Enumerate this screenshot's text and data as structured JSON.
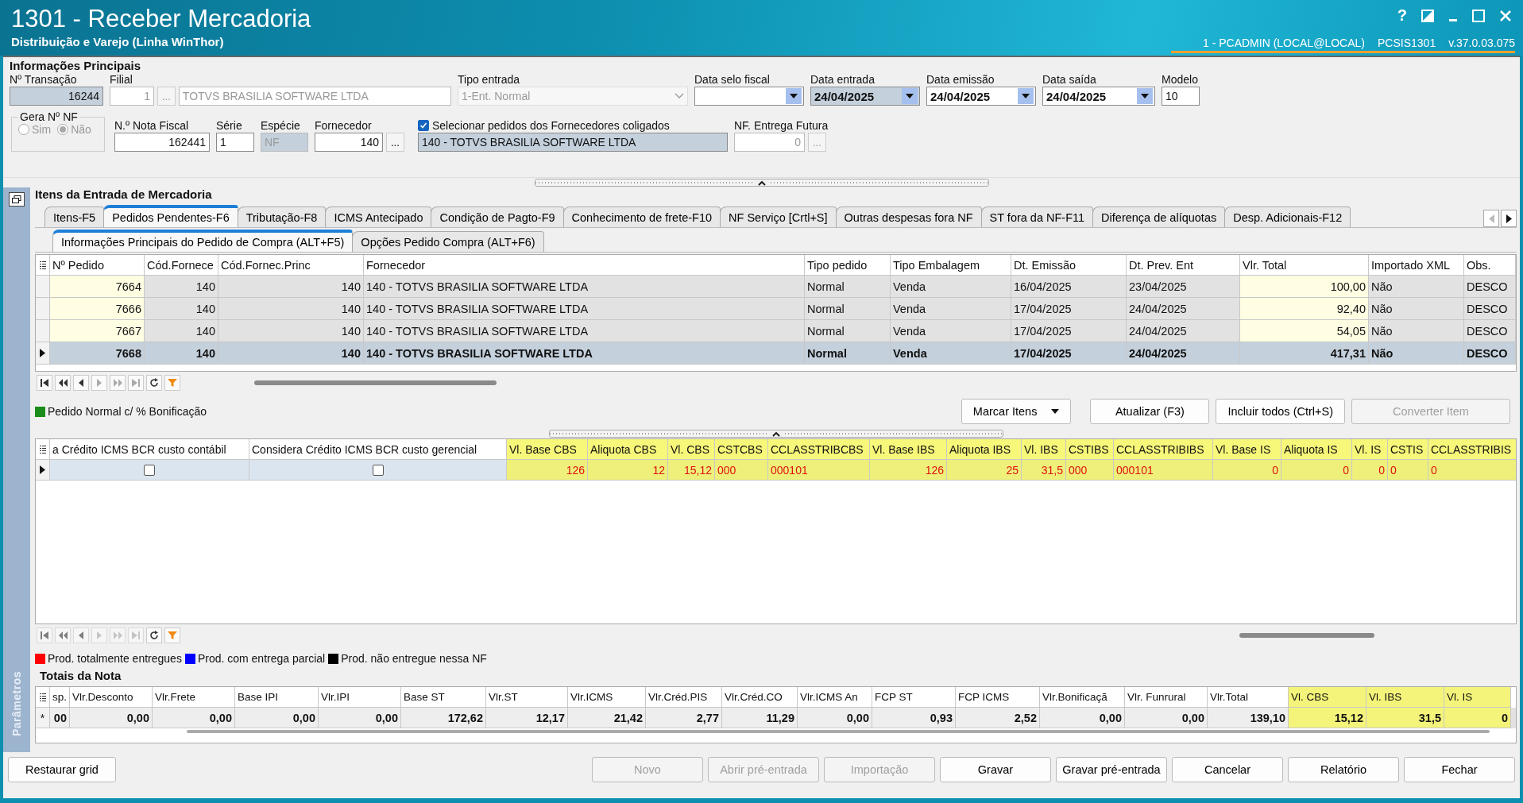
{
  "window": {
    "title": "1301 - Receber Mercadoria",
    "subtitle": "Distribuição e Varejo (Linha WinThor)",
    "help": "?",
    "user": "1 - PCADMIN (LOCAL@LOCAL)",
    "program": "PCSIS1301",
    "version": "v.37.0.03.075"
  },
  "main_info": {
    "heading": "Informações Principais",
    "row1": [
      {
        "kind": "text",
        "label": "Nº Transação",
        "value": "16244",
        "readonly": true,
        "disabled": false
      },
      {
        "kind": "lookup",
        "label": "Filial",
        "value": "1",
        "button": "...",
        "name": "TOTVS BRASILIA SOFTWARE LTDA",
        "readonly": false,
        "disabled": true
      },
      {
        "kind": "select",
        "label": "Tipo entrada",
        "value": "1-Ent. Normal",
        "readonly": false,
        "disabled": true
      },
      {
        "kind": "date",
        "label": "Data selo fiscal",
        "readonly": false,
        "disabled": false
      },
      {
        "kind": "date",
        "label": "Data entrada",
        "value": "24/04/2025",
        "readonly": true,
        "disabled": false
      },
      {
        "kind": "date",
        "label": "Data emissão",
        "value": "24/04/2025",
        "readonly": false,
        "disabled": false
      },
      {
        "kind": "date",
        "label": "Data saída",
        "value": "24/04/2025",
        "readonly": false,
        "disabled": false
      },
      {
        "kind": "text",
        "label": "Modelo",
        "value": "10",
        "readonly": false,
        "disabled": false
      }
    ],
    "gera_nf": {
      "label": "Gera Nº NF",
      "disabled": true,
      "options": [
        {
          "label": "Sim",
          "selected": false
        },
        {
          "label": "Não",
          "selected": true
        }
      ]
    },
    "row2": [
      {
        "kind": "text",
        "label": "N.º Nota Fiscal",
        "value": "162441",
        "readonly": false,
        "disabled": false
      },
      {
        "kind": "text",
        "label": "Série",
        "value": "1",
        "readonly": false,
        "disabled": false
      },
      {
        "kind": "text",
        "label": "Espécie",
        "value": "NF",
        "readonly": true,
        "disabled": true
      },
      {
        "kind": "lookup",
        "label": "Fornecedor",
        "value": "140",
        "button": "...",
        "readonly": false,
        "disabled": false
      },
      {
        "kind": "checkname",
        "label": "Selecionar pedidos dos Fornecedores coligados",
        "checked": true,
        "value": "140 - TOTVS BRASILIA SOFTWARE LTDA",
        "readonly": true
      },
      {
        "kind": "lookup",
        "label": "NF. Entrega Futura",
        "value": "0",
        "button": "...",
        "readonly": false,
        "disabled": true
      }
    ]
  },
  "items": {
    "heading": "Itens da Entrada de Mercadoria",
    "tabs": [
      {
        "label": "Itens-F5",
        "selected": false
      },
      {
        "label": "Pedidos Pendentes-F6",
        "selected": true
      },
      {
        "label": "Tributação-F8",
        "selected": false
      },
      {
        "label": "ICMS Antecipado",
        "selected": false
      },
      {
        "label": "Condição de Pagto-F9",
        "selected": false
      },
      {
        "label": "Conhecimento de frete-F10",
        "selected": false
      },
      {
        "label": "NF Serviço [Crtl+S]",
        "selected": false
      },
      {
        "label": "Outras despesas fora NF",
        "selected": false
      },
      {
        "label": "ST fora da NF-F11",
        "selected": false
      },
      {
        "label": "Diferença de alíquotas",
        "selected": false
      },
      {
        "label": "Desp. Adicionais-F12",
        "selected": false
      }
    ],
    "subtabs": [
      {
        "label": "Informações Principais do Pedido de Compra (ALT+F5)",
        "selected": true
      },
      {
        "label": "Opções Pedido Compra (ALT+F6)",
        "selected": false
      }
    ]
  },
  "orders": {
    "columns": [
      {
        "label": "Nº Pedido",
        "highlight": true
      },
      {
        "label": "Cód.Fornece",
        "highlight": false
      },
      {
        "label": "Cód.Fornec.Princ",
        "highlight": false
      },
      {
        "label": "Fornecedor",
        "highlight": false
      },
      {
        "label": "Tipo pedido",
        "highlight": false
      },
      {
        "label": "Tipo Embalagem",
        "highlight": false
      },
      {
        "label": "Dt. Emissão",
        "highlight": false
      },
      {
        "label": "Dt. Prev. Ent",
        "highlight": false
      },
      {
        "label": "Vlr. Total",
        "highlight": true
      },
      {
        "label": "Importado XML",
        "highlight": false
      },
      {
        "label": "Obs.",
        "highlight": false
      }
    ],
    "rows": [
      {
        "selected": false,
        "cells": [
          "7664",
          "140",
          "140",
          "140 - TOTVS BRASILIA SOFTWARE LTDA",
          "Normal",
          "Venda",
          "16/04/2025",
          "23/04/2025",
          "100,00",
          "Não",
          "DESCO"
        ]
      },
      {
        "selected": false,
        "cells": [
          "7666",
          "140",
          "140",
          "140 - TOTVS BRASILIA SOFTWARE LTDA",
          "Normal",
          "Venda",
          "17/04/2025",
          "24/04/2025",
          "92,40",
          "Não",
          "DESCO"
        ]
      },
      {
        "selected": false,
        "cells": [
          "7667",
          "140",
          "140",
          "140 - TOTVS BRASILIA SOFTWARE LTDA",
          "Normal",
          "Venda",
          "17/04/2025",
          "24/04/2025",
          "54,05",
          "Não",
          "DESCO"
        ]
      },
      {
        "selected": true,
        "cells": [
          "7668",
          "140",
          "140",
          "140 - TOTVS BRASILIA SOFTWARE LTDA",
          "Normal",
          "Venda",
          "17/04/2025",
          "24/04/2025",
          "417,31",
          "Não",
          "DESCO"
        ]
      }
    ]
  },
  "legend_bonus": {
    "color": "#1a8c1a",
    "label": "Pedido Normal c/ % Bonificação"
  },
  "actions": [
    {
      "kind": "dropdown",
      "label": "Marcar Itens",
      "disabled": false
    },
    {
      "kind": "button",
      "label": "Atualizar (F3)",
      "disabled": false
    },
    {
      "kind": "button",
      "label": "Incluir todos (Ctrl+S)",
      "disabled": false
    },
    {
      "kind": "button",
      "label": "Converter Item",
      "disabled": true
    }
  ],
  "tax_items": {
    "columns": [
      {
        "label": "a Crédito ICMS BCR custo contábil",
        "highlight": false
      },
      {
        "label": "Considera Crédito ICMS BCR custo gerencial",
        "highlight": false
      },
      {
        "label": "Vl. Base CBS",
        "highlight": true
      },
      {
        "label": "Aliquota CBS",
        "highlight": true
      },
      {
        "label": "Vl. CBS",
        "highlight": true
      },
      {
        "label": "CSTCBS",
        "highlight": true
      },
      {
        "label": "CCLASSTRIBCBS",
        "highlight": true
      },
      {
        "label": "Vl. Base IBS",
        "highlight": true
      },
      {
        "label": "Aliquota IBS",
        "highlight": true
      },
      {
        "label": "Vl. IBS",
        "highlight": true
      },
      {
        "label": "CSTIBS",
        "highlight": true
      },
      {
        "label": "CCLASSTRIBIBS",
        "highlight": true
      },
      {
        "label": "Vl. Base IS",
        "highlight": true
      },
      {
        "label": "Aliquota IS",
        "highlight": true
      },
      {
        "label": "Vl. IS",
        "highlight": true
      },
      {
        "label": "CSTIS",
        "highlight": true
      },
      {
        "label": "CCLASSTRIBIS",
        "highlight": true
      }
    ],
    "rows": [
      {
        "selected": true,
        "flags": [
          false,
          false
        ],
        "values": [
          "126",
          "12",
          "15,12",
          "000",
          "000101",
          "126",
          "25",
          "31,5",
          "000",
          "000101",
          "0",
          "0",
          "0",
          "0",
          "0"
        ]
      }
    ]
  },
  "legend_delivery": [
    {
      "color": "#ff0000",
      "label": "Prod. totalmente entregues"
    },
    {
      "color": "#0000ff",
      "label": "Prod. com entrega parcial"
    },
    {
      "color": "#000000",
      "label": "Prod. não entregue nessa NF"
    }
  ],
  "totals": {
    "heading": "Totais da Nota",
    "columns": [
      {
        "label": "sp.",
        "highlight": false
      },
      {
        "label": "Vlr.Desconto",
        "highlight": false
      },
      {
        "label": "Vlr.Frete",
        "highlight": false
      },
      {
        "label": "Base IPI",
        "highlight": false
      },
      {
        "label": "Vlr.IPI",
        "highlight": false
      },
      {
        "label": "Base ST",
        "highlight": false
      },
      {
        "label": "Vlr.ST",
        "highlight": false
      },
      {
        "label": "Vlr.ICMS",
        "highlight": false
      },
      {
        "label": "Vlr.Créd.PIS",
        "highlight": false
      },
      {
        "label": "Vlr.Créd.CO",
        "highlight": false
      },
      {
        "label": "Vlr.ICMS An",
        "highlight": false
      },
      {
        "label": "FCP ST",
        "highlight": false
      },
      {
        "label": "FCP ICMS",
        "highlight": false
      },
      {
        "label": "Vlr.Bonificaçã",
        "highlight": false
      },
      {
        "label": "Vlr. Funrural",
        "highlight": false
      },
      {
        "label": "Vlr.Total",
        "highlight": false
      },
      {
        "label": "Vl. CBS",
        "highlight": true
      },
      {
        "label": "Vl. IBS",
        "highlight": true
      },
      {
        "label": "Vl. IS",
        "highlight": true
      }
    ],
    "rows": [
      {
        "marker": "*",
        "values": [
          "00",
          "0,00",
          "0,00",
          "0,00",
          "0,00",
          "172,62",
          "12,17",
          "21,42",
          "2,77",
          "11,29",
          "0,00",
          "0,93",
          "2,52",
          "0,00",
          "0,00",
          "139,10",
          "15,12",
          "31,5",
          "0"
        ]
      }
    ]
  },
  "sidebar_label": "Parâmetros",
  "footer": {
    "left": {
      "label": "Restaurar grid",
      "disabled": false
    },
    "buttons": [
      {
        "label": "Novo",
        "disabled": true
      },
      {
        "label": "Abrir pré-entrada",
        "disabled": true
      },
      {
        "label": "Importação",
        "disabled": true
      },
      {
        "label": "Gravar",
        "disabled": false
      },
      {
        "label": "Gravar pré-entrada",
        "disabled": false
      },
      {
        "label": "Cancelar",
        "disabled": false
      },
      {
        "label": "Relatório",
        "disabled": false
      },
      {
        "label": "Fechar",
        "disabled": false
      }
    ]
  }
}
